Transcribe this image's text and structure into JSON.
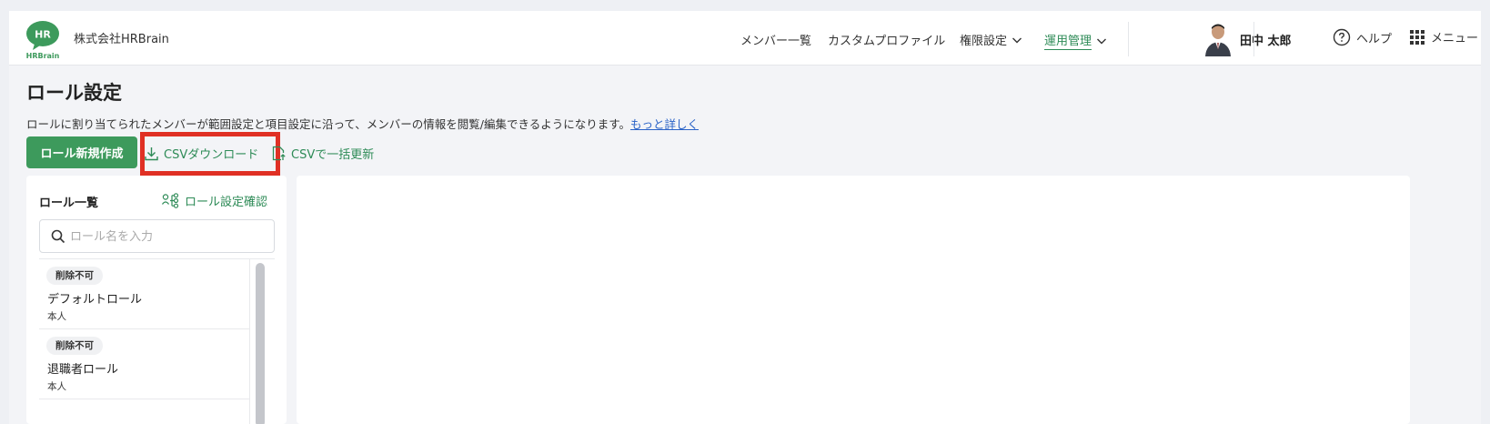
{
  "header": {
    "logo_text": "HR",
    "logo_subtext": "HRBrain",
    "company_name": "株式会社HRBrain",
    "nav": [
      {
        "label": "メンバー一覧"
      },
      {
        "label": "カスタムプロファイル"
      },
      {
        "label": "権限設定"
      },
      {
        "label": "運用管理"
      }
    ],
    "user_name": "田中 太郎",
    "help_label": "ヘルプ",
    "menu_label": "メニュー"
  },
  "page": {
    "title": "ロール設定",
    "description": "ロールに割り当てられたメンバーが範囲設定と項目設定に沿って、メンバーの情報を閲覧/編集できるようになります。",
    "more_link": "もっと詳しく"
  },
  "actions": {
    "create_label": "ロール新規作成",
    "csv_download_label": "CSVダウンロード",
    "csv_update_label": "CSVで一括更新"
  },
  "role_panel": {
    "title": "ロール一覧",
    "confirm_link": "ロール設定確認",
    "search_placeholder": "ロール名を入力",
    "roles": [
      {
        "badge": "削除不可",
        "name": "デフォルトロール",
        "scope": "本人"
      },
      {
        "badge": "削除不可",
        "name": "退職者ロール",
        "scope": "本人"
      }
    ]
  },
  "colors": {
    "brand_green": "#3d9a5c",
    "link_green": "#2e8b57",
    "highlight_red": "#e03024",
    "link_blue": "#2962c7"
  }
}
